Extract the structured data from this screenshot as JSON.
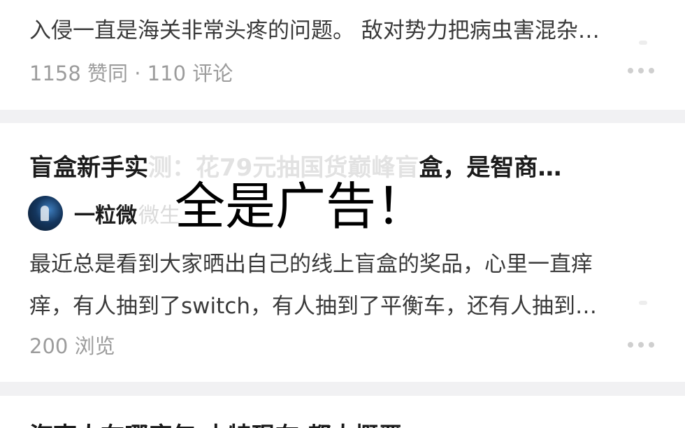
{
  "cards": [
    {
      "excerpt": "入侵一直是海关非常头疼的问题。 敌对势力把病虫害混杂…",
      "meta": "1158 赞同 · 110 评论",
      "more_icon": "more-dots-icon"
    },
    {
      "title_prefix": "盲盒新手实",
      "title_faint": "测：花79元抽国货巅峰盲",
      "title_suffix": "盒，是智商…",
      "author": "一粒微",
      "author_faint": "微生",
      "excerpt_lines": [
        "最近总是看到大家晒出自己的线上盲盒的奖品，心里一直痒",
        "痒，有人抽到了switch，有人抽到了平衡车，还有人抽到…"
      ],
      "meta": "200 浏览",
      "more_icon": "more-dots-icon"
    },
    {
      "title": "海南人在哪座年 土特现在 都大概严…"
    }
  ],
  "overlay_text": "全是广告！"
}
